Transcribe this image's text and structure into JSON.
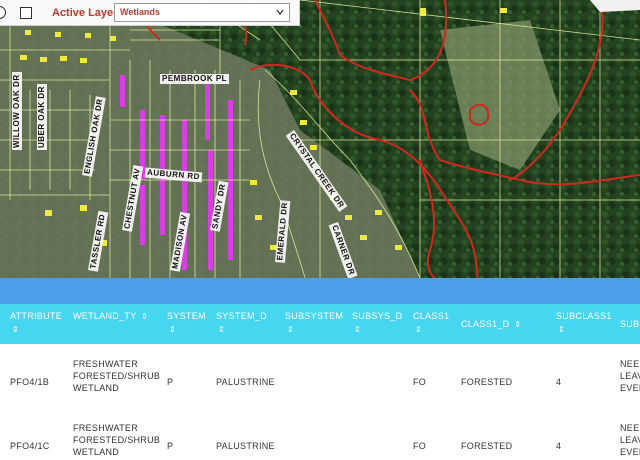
{
  "toolbar": {
    "active_layer_label": "Active Layer:",
    "layer_select_value": "Wetlands"
  },
  "map": {
    "street_labels": [
      "PEMBROOK PL",
      "WILLOW OAK DR",
      "UBER OAK DR",
      "ENGLISH OAK DR",
      "CHESTNUT AV",
      "AUBURN RD",
      "TASSLER RD",
      "MADISON AV",
      "SANDY DR",
      "CRYSTAL CREEK DR",
      "EMERALD DR",
      "CARNER DR"
    ],
    "colors": {
      "forest": "#1f3a1f",
      "wetland_outline": "#d0281e",
      "parcel_lines": "#e8f0a0",
      "parcel_fill": "#f2ea3a",
      "magenta_parcels": "#d63fe0"
    }
  },
  "table": {
    "columns": [
      {
        "label": "ATTRIBUTE",
        "sortable": true
      },
      {
        "label": "WETLAND_TY",
        "sortable": true
      },
      {
        "label": "SYSTEM",
        "sortable": true
      },
      {
        "label": "SYSTEM_D",
        "sortable": true
      },
      {
        "label": "SUBSYSTEM",
        "sortable": true
      },
      {
        "label": "SUBSYS_D",
        "sortable": true
      },
      {
        "label": "CLASS1",
        "sortable": true
      },
      {
        "label": "CLASS1_D",
        "sortable": true
      },
      {
        "label": "SUBCLASS1",
        "sortable": true
      },
      {
        "label": "SUBC",
        "sortable": false
      }
    ],
    "sort_glyph": "⇕",
    "rows": [
      {
        "attribute": "PFO4/1B",
        "wetland_ty": [
          "FRESHWATER",
          "FORESTED/SHRUB",
          "WETLAND"
        ],
        "system": "P",
        "system_d": "PALUSTRINE",
        "subsystem": "",
        "subsys_d": "",
        "class1": "FO",
        "class1_d": "FORESTED",
        "subclass1": "4",
        "subc": [
          "NEED",
          "LEAV",
          "EVER"
        ]
      },
      {
        "attribute": "PFO4/1C",
        "wetland_ty": [
          "FRESHWATER",
          "FORESTED/SHRUB",
          "WETLAND"
        ],
        "system": "P",
        "system_d": "PALUSTRINE",
        "subsystem": "",
        "subsys_d": "",
        "class1": "FO",
        "class1_d": "FORESTED",
        "subclass1": "4",
        "subc": [
          "NEED",
          "LEAV",
          "EVER"
        ]
      }
    ],
    "colors": {
      "header_bg": "#46d6f0",
      "toolbar_bg": "#4a9fe8"
    }
  }
}
